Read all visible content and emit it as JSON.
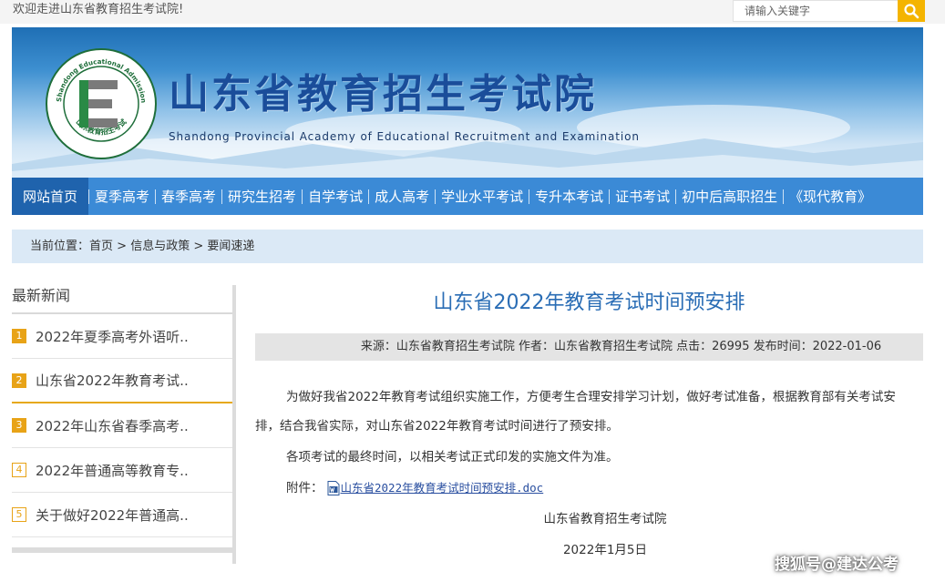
{
  "topbar": {
    "welcome": "欢迎走进山东省教育招生考试院!",
    "search_placeholder": "请输入关键字"
  },
  "banner": {
    "title": "山东省教育招生考试院",
    "subtitle": "Shandong Provincial Academy of Educational Recruitment and Examination",
    "logo_ring_text": "Shandong Educational Admission & Examinations",
    "logo_bottom_text": "山东教育招生考试",
    "logo_letter": "E"
  },
  "nav": {
    "items": [
      {
        "label": "网站首页"
      },
      {
        "label": "夏季高考"
      },
      {
        "label": "春季高考"
      },
      {
        "label": "研究生招考"
      },
      {
        "label": "自学考试"
      },
      {
        "label": "成人高考"
      },
      {
        "label": "学业水平考试"
      },
      {
        "label": "专升本考试"
      },
      {
        "label": "证书考试"
      },
      {
        "label": "初中后高职招生"
      },
      {
        "label": "《现代教育》"
      }
    ]
  },
  "breadcrumb": {
    "prefix": "当前位置：",
    "items": [
      "首页",
      "信息与政策",
      "要闻速递"
    ],
    "separator": " > "
  },
  "sidebar": {
    "title": "最新新闻",
    "items": [
      {
        "num": "1",
        "text": "2022年夏季高考外语听.."
      },
      {
        "num": "2",
        "text": "山东省2022年教育考试.."
      },
      {
        "num": "3",
        "text": "2022年山东省春季高考.."
      },
      {
        "num": "4",
        "text": "2022年普通高等教育专.."
      },
      {
        "num": "5",
        "text": "关于做好2022年普通高.."
      }
    ]
  },
  "article": {
    "title": "山东省2022年教育考试时间预安排",
    "meta": "来源：山东省教育招生考试院 作者：山东省教育招生考试院 点击：26995 发布时间：2022-01-06",
    "para1": "为做好我省2022年教育考试组织实施工作，方便考生合理安排学习计划，做好考试准备，根据教育部有关考试安排，结合我省实际，对山东省2022年教育考试时间进行了预安排。",
    "para2": "各项考试的最终时间，以相关考试正式印发的实施文件为准。",
    "attachment_label": "附件：",
    "attachment_link": "山东省2022年教育考试时间预安排.doc",
    "signer": "山东省教育招生考试院",
    "date": "2022年1月5日"
  },
  "watermark": "搜狐号@建达公考",
  "colors": {
    "nav_bg": "#3b8ad6",
    "nav_active": "#1f63ad",
    "accent_orange": "#e8a317",
    "title_blue": "#2a6db5",
    "breadcrumb_bg": "#dbe9f6"
  }
}
